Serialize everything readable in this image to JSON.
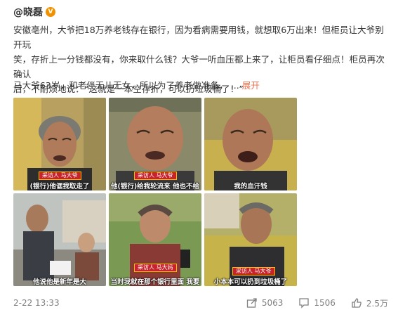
{
  "post": {
    "author": "@晓磊",
    "verified_glyph": "V",
    "text_lines": [
      "安徽亳州，大爷把18万养老钱存在银行，因为看病需要用钱，就想取6万出来！但柜员让大爷别开玩",
      "笑，存折上一分钱都没有，你来取什么钱？大爷一听血压都上来了，让柜员看仔细点！柜员再次确认",
      "后，不耐烦地说：“这就是一本空存折，可以扔垃圾桶了！”"
    ],
    "second_paragraph": "马大爷63岁，和老伴无儿无女，所以为了养老做准备，",
    "ellipsis": "...",
    "expand_label": "展开"
  },
  "images": [
    {
      "caption": "(银行)他诓我取走了",
      "name_bar": "采访人 马大爷"
    },
    {
      "caption": "他(银行)给我轮流来 他也不给",
      "name_bar": "采访人 马大爷"
    },
    {
      "caption": "我的血汗钱",
      "name_bar": ""
    },
    {
      "caption": "他说他是新年是大",
      "name_bar": ""
    },
    {
      "caption": "当时我就在那个银行里面 我要",
      "name_bar": "采访人 马大妈"
    },
    {
      "caption": "小本本可以扔到垃圾桶了",
      "name_bar": "采访人 马大爷"
    }
  ],
  "footer": {
    "timestamp": "2-22 13:33",
    "shares": "5063",
    "comments": "1506",
    "likes": "2.5万",
    "icon_color": "#808080"
  },
  "colors": {
    "expand_link": "#eb7350",
    "verified_badge": "#f29100",
    "caption_bar": "#c8232c"
  }
}
